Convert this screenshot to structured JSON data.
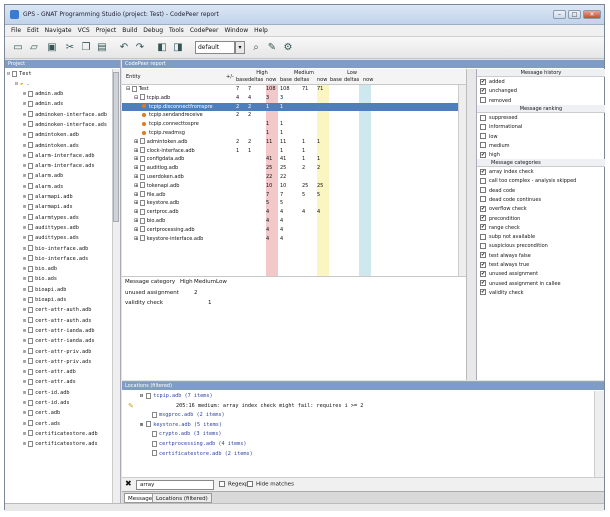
{
  "window": {
    "title": "GPS - GNAT Programming Studio (project: Test) - CodePeer report"
  },
  "menubar": [
    "File",
    "Edit",
    "Navigate",
    "VCS",
    "Project",
    "Build",
    "Debug",
    "Tools",
    "CodePeer",
    "Window",
    "Help"
  ],
  "toolbar": {
    "combo_value": "default"
  },
  "project": {
    "title": "Project",
    "root": "Test",
    "folder": ".",
    "files": [
      "admin.adb",
      "admin.ads",
      "adminoken-interface.adb",
      "adminoken-interface.ads",
      "admintoken.adb",
      "admintoken.ads",
      "alarm-interface.adb",
      "alarm-interface.ads",
      "alarm.adb",
      "alarm.ads",
      "alarmapi.adb",
      "alarmapi.ads",
      "alarmtypes.ads",
      "audittypes.adb",
      "audittypes.ads",
      "bio-interface.adb",
      "bio-interface.ads",
      "bio.adb",
      "bio.ads",
      "bioapi.adb",
      "bioapi.ads",
      "cert-attr-auth.adb",
      "cert-attr-auth.ads",
      "cert-attr-ianda.adb",
      "cert-attr-ianda.ads",
      "cert-attr-priv.adb",
      "cert-attr-priv.ads",
      "cert-attr.adb",
      "cert-attr.ads",
      "cert-id.adb",
      "cert-id.ads",
      "cert.adb",
      "cert.ads",
      "certificatestore.adb",
      "certificatestore.ads"
    ]
  },
  "report": {
    "title": "CodePeer report",
    "headers": {
      "entity": "Entity",
      "plusminus": "+/-",
      "high": "High",
      "medium": "Medium",
      "low": "Low",
      "sub": [
        "base",
        "deltas",
        "now",
        "base",
        "deltas",
        "now",
        "base",
        "deltas",
        "now"
      ]
    },
    "rows": [
      {
        "name": "Test",
        "level": 0,
        "vals": [
          "7",
          "7",
          "108",
          "108",
          "71",
          "71",
          "",
          "",
          ""
        ]
      },
      {
        "name": "tcpip.adb",
        "level": 1,
        "vals": [
          "4",
          "4",
          "3",
          "3",
          "",
          "",
          "",
          "",
          ""
        ]
      },
      {
        "name": "tcpip.disconnectfromspre",
        "level": 2,
        "vals": [
          "2",
          "2",
          "1",
          "1",
          "",
          "",
          "",
          "",
          ""
        ],
        "selected": true
      },
      {
        "name": "tcpip.sendandreceive",
        "level": 2,
        "vals": [
          "2",
          "2",
          "",
          "",
          "",
          "",
          "",
          "",
          ""
        ]
      },
      {
        "name": "tcpip.connecttospre",
        "level": 2,
        "vals": [
          "",
          "",
          "1",
          "1",
          "",
          "",
          "",
          "",
          ""
        ]
      },
      {
        "name": "tcpip.readmsg",
        "level": 2,
        "vals": [
          "",
          "",
          "1",
          "1",
          "",
          "",
          "",
          "",
          ""
        ]
      },
      {
        "name": "admintoken.adb",
        "level": 1,
        "vals": [
          "2",
          "2",
          "11",
          "11",
          "1",
          "1",
          "",
          "",
          ""
        ]
      },
      {
        "name": "clock-interface.adb",
        "level": 1,
        "vals": [
          "1",
          "1",
          "",
          "1",
          "1",
          "",
          "",
          "",
          ""
        ]
      },
      {
        "name": "configdata.adb",
        "level": 1,
        "vals": [
          "",
          "",
          "41",
          "41",
          "1",
          "1",
          "",
          "",
          ""
        ]
      },
      {
        "name": "auditlog.adb",
        "level": 1,
        "vals": [
          "",
          "",
          "25",
          "25",
          "2",
          "2",
          "",
          "",
          ""
        ]
      },
      {
        "name": "userdoken.adb",
        "level": 1,
        "vals": [
          "",
          "",
          "22",
          "22",
          "",
          "",
          "",
          "",
          ""
        ]
      },
      {
        "name": "tokenapi.adb",
        "level": 1,
        "vals": [
          "",
          "",
          "10",
          "10",
          "25",
          "25",
          "",
          "",
          ""
        ]
      },
      {
        "name": "file.adb",
        "level": 1,
        "vals": [
          "",
          "",
          "7",
          "7",
          "5",
          "5",
          "",
          "",
          ""
        ]
      },
      {
        "name": "keystore.adb",
        "level": 1,
        "vals": [
          "",
          "",
          "5",
          "5",
          "",
          "",
          "",
          "",
          ""
        ]
      },
      {
        "name": "certproc.adb",
        "level": 1,
        "vals": [
          "",
          "",
          "4",
          "4",
          "4",
          "4",
          "",
          "",
          ""
        ]
      },
      {
        "name": "bio.adb",
        "level": 1,
        "vals": [
          "",
          "",
          "4",
          "4",
          "",
          "",
          "",
          "",
          ""
        ]
      },
      {
        "name": "certprocessing.adb",
        "level": 1,
        "vals": [
          "",
          "",
          "4",
          "4",
          "",
          "",
          "",
          "",
          ""
        ]
      },
      {
        "name": "keystore-interface.adb",
        "level": 1,
        "vals": [
          "",
          "",
          "4",
          "4",
          "",
          "",
          "",
          "",
          ""
        ]
      }
    ],
    "bottom": {
      "headers": [
        "Message category",
        "High",
        "Medium",
        "Low"
      ],
      "rows": [
        {
          "name": "unused assignment",
          "val": "2"
        },
        {
          "name": "validity check",
          "val": "1"
        }
      ]
    }
  },
  "filters": {
    "history_title": "Message history",
    "history": [
      {
        "label": "added",
        "on": true
      },
      {
        "label": "unchanged",
        "on": true
      },
      {
        "label": "removed",
        "on": false
      }
    ],
    "ranking_title": "Message ranking",
    "ranking": [
      {
        "label": "suppressed",
        "on": false
      },
      {
        "label": "informational",
        "on": false
      },
      {
        "label": "low",
        "on": false
      },
      {
        "label": "medium",
        "on": false
      },
      {
        "label": "high",
        "on": true
      }
    ],
    "categories_title": "Message categories",
    "categories": [
      {
        "label": "array index check",
        "on": true
      },
      {
        "label": "call too complex - analysis skipped",
        "on": false
      },
      {
        "label": "dead code",
        "on": false
      },
      {
        "label": "dead code continues",
        "on": false
      },
      {
        "label": "overflow check",
        "on": true
      },
      {
        "label": "precondition",
        "on": true
      },
      {
        "label": "range check",
        "on": true
      },
      {
        "label": "subp not available",
        "on": false
      },
      {
        "label": "suspicious precondition",
        "on": false
      },
      {
        "label": "test always false",
        "on": true
      },
      {
        "label": "test always true",
        "on": true
      },
      {
        "label": "unused assignment",
        "on": true
      },
      {
        "label": "unused assignment in callee",
        "on": true
      },
      {
        "label": "validity check",
        "on": true
      }
    ]
  },
  "locations": {
    "title": "Locations (filtered)",
    "rows": [
      {
        "indent": 8,
        "text": "tcpip.adb (7 items)",
        "exp": "⊟"
      },
      {
        "indent": 44,
        "text": "205:16    medium: array index check might fail: requires i >= 2",
        "exp": ""
      },
      {
        "indent": 20,
        "text": "msgproc.adb (2 items)",
        "exp": ""
      },
      {
        "indent": 8,
        "text": "keystore.adb (5 items)",
        "exp": "⊞"
      },
      {
        "indent": 20,
        "text": "crypto.adb (3 items)",
        "exp": ""
      },
      {
        "indent": 20,
        "text": "certprocessing.adb (4 items)",
        "exp": ""
      },
      {
        "indent": 20,
        "text": "certificatestore.adb (2 items)",
        "exp": ""
      }
    ],
    "search_value": "array",
    "regexp_label": "Regexp",
    "hide_label": "Hide matches"
  },
  "tabs": [
    "Messages",
    "Locations (filtered)"
  ],
  "colors": {
    "high": "#f3c8c8",
    "medium": "#fbf5c2",
    "low": "#cfe8ee",
    "selection": "#4f7ebd",
    "panel_title": "#7f9cc6"
  }
}
